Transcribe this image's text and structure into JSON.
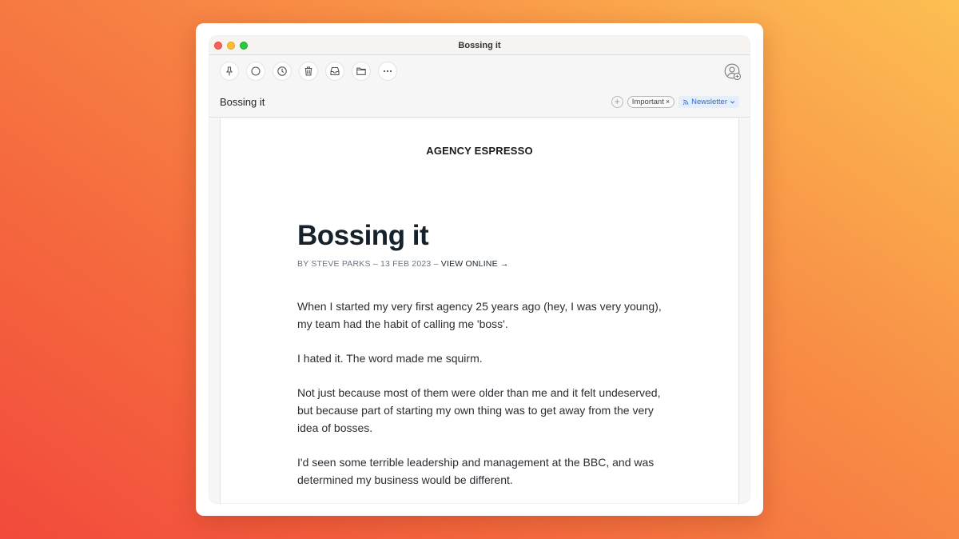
{
  "window": {
    "title": "Bossing it"
  },
  "toolbar": {
    "buttons": [
      {
        "icon": "pin-icon"
      },
      {
        "icon": "circle-icon"
      },
      {
        "icon": "clock-icon"
      },
      {
        "icon": "trash-icon"
      },
      {
        "icon": "inbox-icon"
      },
      {
        "icon": "folder-icon"
      },
      {
        "icon": "more-icon"
      }
    ],
    "avatar_icon": "add-contact-icon"
  },
  "subject_bar": {
    "subject": "Bossing it",
    "add_tag_symbol": "+",
    "tag_label": "Important",
    "tag_remove_symbol": "×",
    "category_label": "Newsletter"
  },
  "email": {
    "brand": "AGENCY ESPRESSO",
    "headline": "Bossing it",
    "meta_byline": "BY STEVE PARKS – 13 FEB 2023 – ",
    "meta_view_online": "VIEW ONLINE →",
    "paragraphs": [
      "When I started my very first agency 25 years ago (hey, I was very young), my team had the habit of calling me 'boss'.",
      "I hated it. The word made me squirm.",
      "Not just because most of them were older than me and it felt undeserved, but because part of starting my own thing was to get away from the very idea of bosses.",
      "I'd seen some terrible leadership and management at the BBC, and was determined my business would be different."
    ]
  },
  "colors": {
    "accent_blue": "#2d6ad2",
    "traffic_red": "#fe5f57",
    "traffic_yellow": "#febc2e",
    "traffic_green": "#28c840"
  }
}
